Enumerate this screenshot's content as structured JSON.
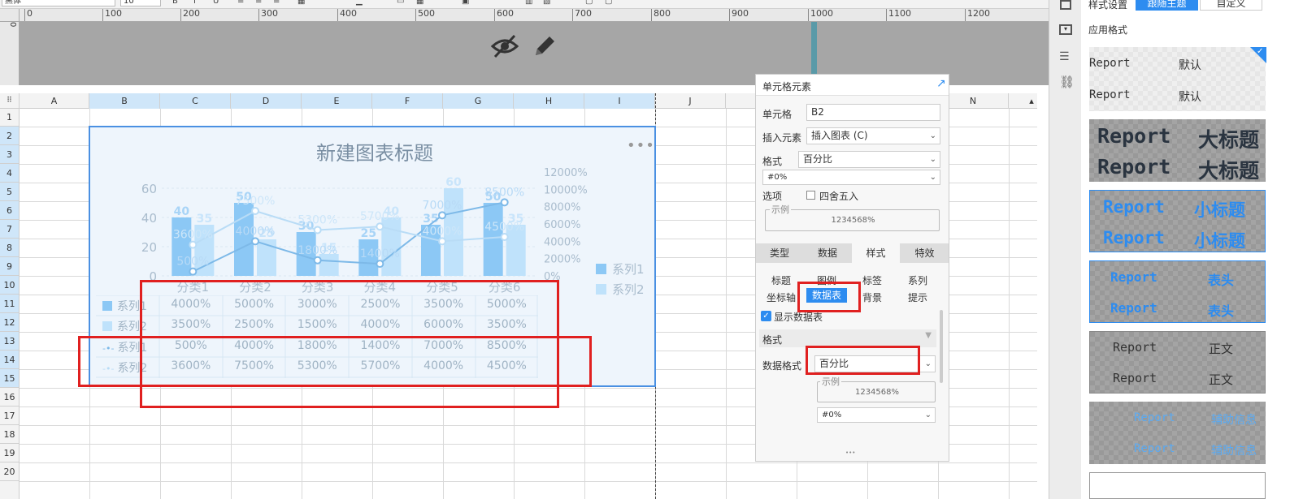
{
  "toolbar": {
    "font_name": "黑体",
    "font_size": "10"
  },
  "ruler": {
    "h_ticks": [
      "0",
      "100",
      "200",
      "300",
      "400",
      "500",
      "600",
      "700",
      "800",
      "900",
      "1000",
      "1100",
      "1200"
    ],
    "v_tick": "0"
  },
  "grid": {
    "columns": [
      "A",
      "B",
      "C",
      "D",
      "E",
      "F",
      "G",
      "H",
      "I",
      "J",
      "K",
      "L",
      "M",
      "N"
    ],
    "rows": [
      "1",
      "2",
      "3",
      "4",
      "5",
      "6",
      "7",
      "8",
      "9",
      "10",
      "11",
      "12",
      "13",
      "14",
      "15",
      "16",
      "17",
      "18",
      "19",
      "20"
    ]
  },
  "chart": {
    "title": "新建图表标题",
    "more": "•••",
    "left_axis_ticks": [
      "60",
      "40",
      "20",
      "0"
    ],
    "right_axis_ticks": [
      "12000%",
      "10000%",
      "8000%",
      "6000%",
      "4000%",
      "2000%",
      "0%"
    ],
    "categories": [
      "分类1",
      "分类2",
      "分类3",
      "分类4",
      "分类5",
      "分类6"
    ],
    "legend": [
      "系列1",
      "系列2"
    ],
    "data_table": [
      {
        "name": "系列1",
        "values": [
          "4000%",
          "5000%",
          "3000%",
          "2500%",
          "3500%",
          "5000%"
        ]
      },
      {
        "name": "系列2",
        "values": [
          "3500%",
          "2500%",
          "1500%",
          "4000%",
          "6000%",
          "3500%"
        ]
      },
      {
        "name": "系列1",
        "values": [
          "500%",
          "4000%",
          "1800%",
          "1400%",
          "7000%",
          "8500%"
        ]
      },
      {
        "name": "系列2",
        "values": [
          "3600%",
          "7500%",
          "5300%",
          "5700%",
          "4000%",
          "4500%"
        ]
      }
    ]
  },
  "chart_data": {
    "type": "bar",
    "title": "新建图表标题",
    "categories": [
      "分类1",
      "分类2",
      "分类3",
      "分类4",
      "分类5",
      "分类6"
    ],
    "ylim": [
      0,
      60
    ],
    "y2lim": [
      0,
      12000
    ],
    "series": [
      {
        "name": "系列1",
        "type": "bar",
        "values": [
          40,
          50,
          30,
          25,
          35,
          50
        ]
      },
      {
        "name": "系列2",
        "type": "bar",
        "values": [
          35,
          25,
          15,
          40,
          60,
          35
        ]
      },
      {
        "name": "系列1",
        "type": "line",
        "axis": "right",
        "values": [
          500,
          4000,
          1800,
          1400,
          7000,
          8500
        ]
      },
      {
        "name": "系列2",
        "type": "line",
        "axis": "right",
        "values": [
          3600,
          7500,
          5300,
          5700,
          4000,
          4500
        ]
      }
    ],
    "bar_labels": [
      "40",
      "35",
      "50",
      "25",
      "30",
      "15",
      "25",
      "40",
      "35",
      "60",
      "50",
      "35"
    ],
    "line_labels": [
      "500%",
      "3600%",
      "4000%",
      "7500%",
      "1800%",
      "5300%",
      "1400%",
      "5700%",
      "7000%",
      "4000%",
      "8500%",
      "4500%"
    ],
    "colors": {
      "bar1": "#8cc8f5",
      "bar2": "#bfe2fb",
      "line1": "#7db9e8",
      "line2": "#b9dcf6"
    },
    "legend_position": "right"
  },
  "panel": {
    "title": "单元格元素",
    "cell_label": "单元格",
    "cell_value": "B2",
    "insert_label": "插入元素",
    "insert_value": "插入图表 (C)",
    "format_label": "格式",
    "format_value": "百分比",
    "format_pattern": "#0%",
    "option_label": "选项",
    "round_label": "四舍五入",
    "example_label": "示例",
    "example_value": "1234568%",
    "tabs": [
      "类型",
      "数据",
      "样式",
      "特效"
    ],
    "subtabs": [
      "标题",
      "图例",
      "标签",
      "系列",
      "坐标轴",
      "数据表",
      "背景",
      "提示"
    ],
    "show_table_label": "显示数据表",
    "section_label": "格式",
    "data_format_label": "数据格式",
    "data_format_value": "百分比",
    "example2_label": "示例",
    "example2_value": "1234568%",
    "pattern2": "#0%",
    "grip": "•••"
  },
  "stylepanel": {
    "header_label": "样式设置",
    "tab_follow": "跟随主题",
    "tab_custom": "自定义",
    "apply_label": "应用格式",
    "items": [
      {
        "left": "Report",
        "right": "默认"
      },
      {
        "left": "Report",
        "right": "大标题"
      },
      {
        "left": "Report",
        "right": "小标题"
      },
      {
        "left": "Report",
        "right": "表头"
      },
      {
        "left": "Report",
        "right": "正文"
      },
      {
        "left": "Report",
        "right": "辅助信息"
      }
    ]
  }
}
